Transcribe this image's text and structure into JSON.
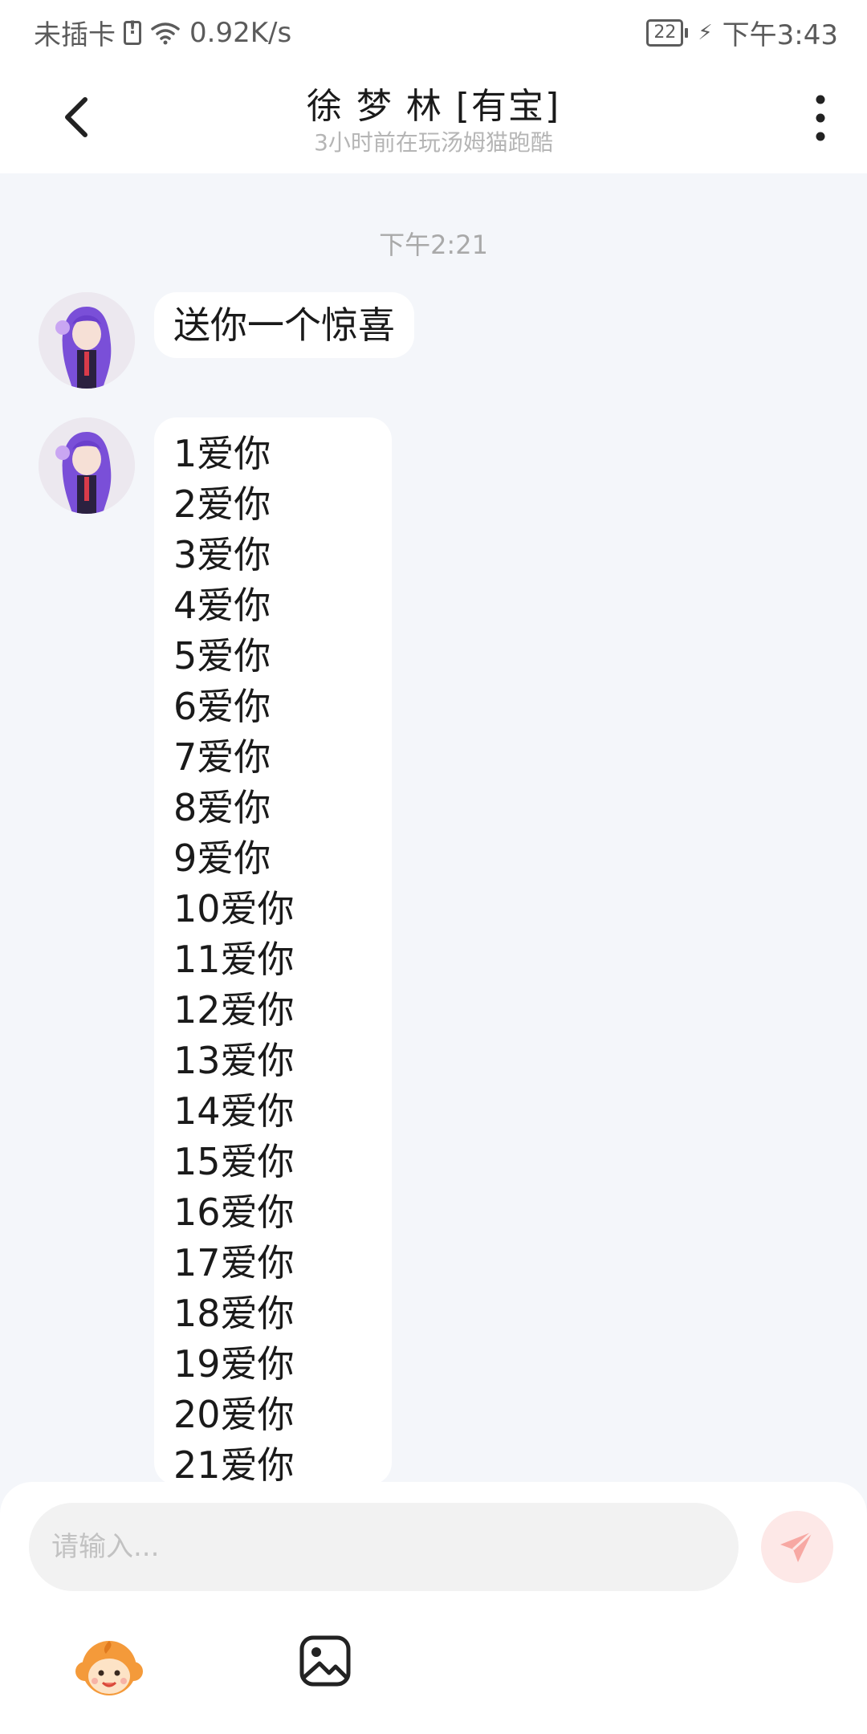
{
  "status_bar": {
    "sim_text": "未插卡",
    "speed": "0.92K/s",
    "battery": "22",
    "time": "下午3:43"
  },
  "header": {
    "title": "徐 梦 林 [有宝]",
    "subtitle": "3小时前在玩汤姆猫跑酷"
  },
  "chat": {
    "timestamp": "下午2:21",
    "messages": [
      {
        "sender": "other",
        "text": "送你一个惊喜"
      },
      {
        "sender": "other",
        "lines": [
          "1爱你",
          "2爱你",
          "3爱你",
          "4爱你",
          "5爱你",
          "6爱你",
          "7爱你",
          "8爱你",
          "9爱你",
          "10爱你",
          "11爱你",
          "12爱你",
          "13爱你",
          "14爱你",
          "15爱你",
          "16爱你",
          "17爱你",
          "18爱你",
          "19爱你",
          "20爱你",
          "21爱你"
        ]
      }
    ]
  },
  "input": {
    "placeholder": "请输入..."
  },
  "colors": {
    "background": "#f4f6fa",
    "bubble": "#ffffff",
    "send_button": "#fde8e7",
    "send_arrow": "#f7a8a3"
  },
  "icons": {
    "back": "chevron-left-icon",
    "more": "more-vertical-icon",
    "send": "paper-plane-icon",
    "emoji": "monkey-emoji-icon",
    "image": "image-icon"
  }
}
